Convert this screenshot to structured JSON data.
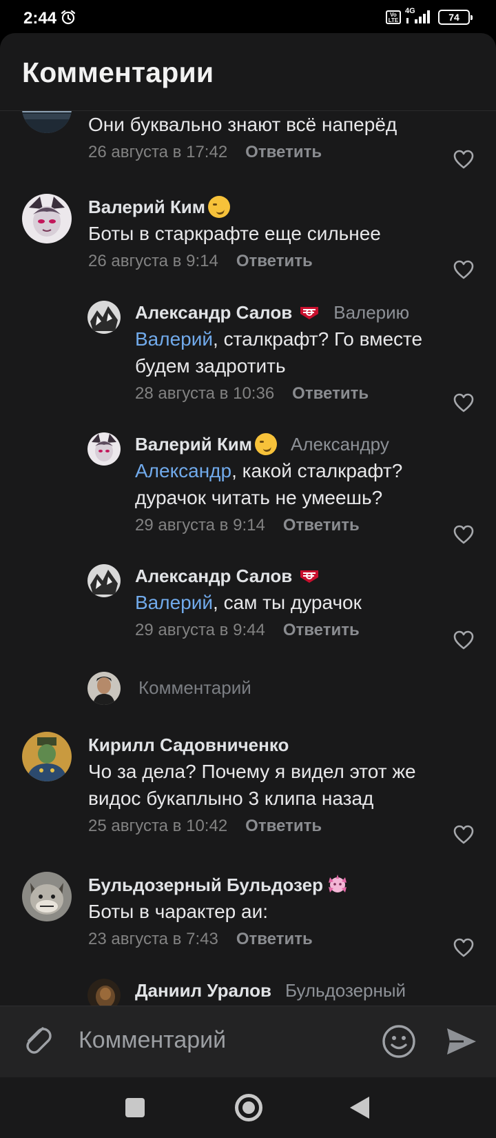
{
  "status_bar": {
    "time": "2:44",
    "volte": "Vo LTE",
    "network": "4G",
    "battery": "74"
  },
  "sheet": {
    "title": "Комментарии"
  },
  "comments": [
    {
      "text": "Они буквально знают всё наперёд",
      "date": "26 августа в 17:42",
      "reply_label": "Ответить"
    },
    {
      "author": "Валерий Ким",
      "text": "Боты в старкрафте еще сильнее",
      "date": "26 августа в 9:14",
      "reply_label": "Ответить"
    },
    {
      "author": "Александр Салов",
      "reply_to": "Валерию",
      "mention": "Валерий",
      "text": ", сталкрафт? Го вместе будем задротить",
      "date": "28 августа в 10:36",
      "reply_label": "Ответить"
    },
    {
      "author": "Валерий Ким",
      "reply_to": "Александру",
      "mention": "Александр",
      "text": ", какой сталкрафт? дурачок читать не умеешь?",
      "date": "29 августа в 9:14",
      "reply_label": "Ответить"
    },
    {
      "author": "Александр Салов",
      "mention": "Валерий",
      "text": ", сам ты дурачок",
      "date": "29 августа в 9:44",
      "reply_label": "Ответить"
    },
    {
      "author": "Кирилл Садовниченко",
      "text": "Чо за дела? Почему я видел этот же видос букаплыно 3 клипа назад",
      "date": "25 августа в 10:42",
      "reply_label": "Ответить"
    },
    {
      "author": "Бульдозерный Бульдозер",
      "text": "Боты в чарактер аи:",
      "date": "23 августа в 7:43",
      "reply_label": "Ответить"
    },
    {
      "author": "Даниил Уралов",
      "reply_to": "Бульдозерный"
    }
  ],
  "inline_reply": {
    "placeholder": "Комментарий"
  },
  "composer": {
    "placeholder": "Комментарий"
  },
  "colors": {
    "background": "#19191a",
    "mention": "#71aaeb",
    "secondary_text": "#828282"
  }
}
